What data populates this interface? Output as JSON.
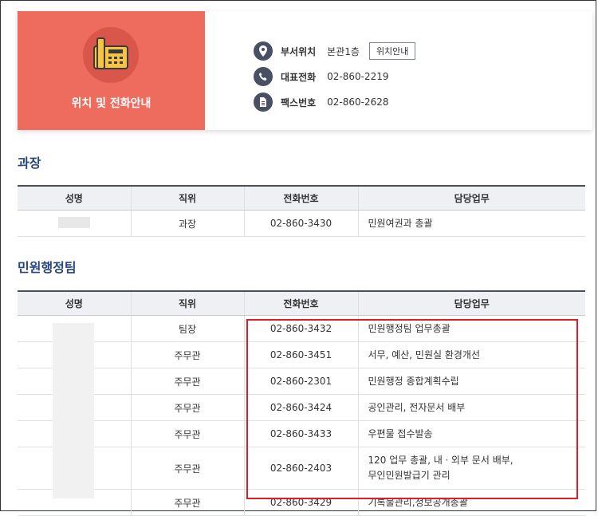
{
  "hero": {
    "title": "위치 및 전화안내",
    "location_label": "부서위치",
    "location_value": "본관1층",
    "location_button": "위치안내",
    "phone_label": "대표전화",
    "phone_value": "02-860-2219",
    "fax_label": "팩스번호",
    "fax_value": "02-860-2628"
  },
  "section1": {
    "title": "과장",
    "headers": [
      "성명",
      "직위",
      "전화번호",
      "담당업무"
    ],
    "rows": [
      {
        "name": "",
        "position": "과장",
        "phone": "02-860-3430",
        "duty": "민원여권과 총괄"
      }
    ]
  },
  "section2": {
    "title": "민원행정팀",
    "headers": [
      "성명",
      "직위",
      "전화번호",
      "담당업무"
    ],
    "rows": [
      {
        "name": "",
        "position": "팀장",
        "phone": "02-860-3432",
        "duty": "민원행정팀 업무총괄"
      },
      {
        "name": "",
        "position": "주무관",
        "phone": "02-860-3451",
        "duty": "서무, 예산, 민원실 환경개선"
      },
      {
        "name": "",
        "position": "주무관",
        "phone": "02-860-2301",
        "duty": "민원행정 종합계획수립"
      },
      {
        "name": "",
        "position": "주무관",
        "phone": "02-860-3424",
        "duty": "공인관리, 전자문서 배부"
      },
      {
        "name": "",
        "position": "주무관",
        "phone": "02-860-3433",
        "duty": "우편물 접수발송"
      },
      {
        "name": "",
        "position": "주무관",
        "phone": "02-860-2403",
        "duty_line1": "120 업무 총괄, 내ㆍ외부 문서 배부,",
        "duty_line2": "무인민원발급기 관리"
      },
      {
        "name": "",
        "position": "주무관",
        "phone": "02-860-3429",
        "duty": "기록물관리,정보공개총괄"
      }
    ]
  },
  "colors": {
    "hero_bg": "#ee6c5d",
    "title_blue": "#27467f",
    "highlight_red": "#e31b23"
  }
}
